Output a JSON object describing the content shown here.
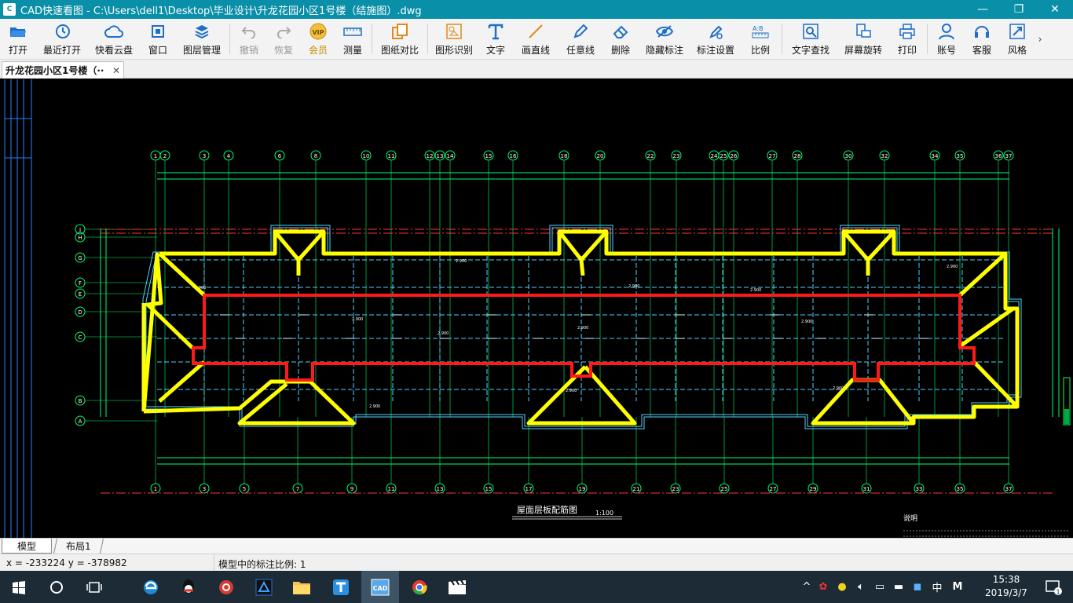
{
  "window": {
    "title": "CAD快速看图 - C:\\Users\\dell1\\Desktop\\毕业设计\\升龙花园小区1号楼（结施图）.dwg",
    "controls": [
      "—",
      "❐",
      "✕"
    ]
  },
  "toolbar": {
    "buttons": [
      {
        "label": "打开",
        "icon": "folder-open-icon"
      },
      {
        "label": "最近打开",
        "icon": "history-icon"
      },
      {
        "label": "快看云盘",
        "icon": "cloud-icon"
      },
      {
        "label": "窗口",
        "icon": "window-icon"
      },
      {
        "label": "图层管理",
        "icon": "layers-icon"
      },
      {
        "label": "撤销",
        "icon": "undo-icon"
      },
      {
        "label": "恢复",
        "icon": "redo-icon"
      },
      {
        "label": "会员",
        "icon": "vip-icon"
      },
      {
        "label": "测量",
        "icon": "ruler-icon"
      },
      {
        "label": "图纸对比",
        "icon": "compare-icon"
      },
      {
        "label": "图形识别",
        "icon": "shape-recognize-icon"
      },
      {
        "label": "文字",
        "icon": "text-icon"
      },
      {
        "label": "画直线",
        "icon": "line-icon"
      },
      {
        "label": "任意线",
        "icon": "pen-icon"
      },
      {
        "label": "删除",
        "icon": "eraser-icon"
      },
      {
        "label": "隐藏标注",
        "icon": "eye-hide-icon"
      },
      {
        "label": "标注设置",
        "icon": "annotation-settings-icon"
      },
      {
        "label": "比例",
        "icon": "scale-icon"
      },
      {
        "label": "文字查找",
        "icon": "text-search-icon"
      },
      {
        "label": "屏幕旋转",
        "icon": "rotate-screen-icon"
      },
      {
        "label": "打印",
        "icon": "printer-icon"
      },
      {
        "label": "账号",
        "icon": "user-icon"
      },
      {
        "label": "客服",
        "icon": "headset-icon"
      },
      {
        "label": "风格",
        "icon": "style-icon"
      }
    ],
    "more": "›"
  },
  "tab": {
    "label": "升龙花园小区1号楼（··",
    "close": "✕"
  },
  "drawing": {
    "grid_top": [
      "1",
      "2",
      "3",
      "4",
      "6",
      "8",
      "10",
      "11",
      "12",
      "13",
      "14",
      "15",
      "16",
      "18",
      "20",
      "22",
      "23",
      "24",
      "25",
      "26",
      "27",
      "28",
      "30",
      "32",
      "34",
      "35",
      "36",
      "37"
    ],
    "grid_bottom": [
      "1",
      "3",
      "5",
      "7",
      "9",
      "11",
      "13",
      "15",
      "17",
      "19",
      "21",
      "23",
      "25",
      "27",
      "29",
      "31",
      "33",
      "35",
      "37"
    ],
    "grid_rows": [
      "J",
      "H",
      "G",
      "F",
      "E",
      "D",
      "C",
      "B",
      "A"
    ],
    "plan_title": "屋面层板配筋图",
    "plan_scale": "1:100",
    "notes_heading": "说明"
  },
  "layout_tabs": {
    "model": "模型",
    "layout1": "布局1"
  },
  "status": {
    "coords": "x = -233224  y = -378982",
    "scale": "模型中的标注比例: 1"
  },
  "taskbar": {
    "apps": [
      "windows-start-icon",
      "cortana-icon",
      "task-view-icon",
      "edge-icon",
      "qq-icon",
      "netease-music-icon",
      "app-icon",
      "file-explorer-icon",
      "t-app-icon",
      "cad-viewer-icon",
      "chrome-icon",
      "video-editor-icon"
    ],
    "tray_ime": "中",
    "tray_m": "M",
    "time": "15:38",
    "date": "2019/3/7",
    "notify": "1"
  }
}
